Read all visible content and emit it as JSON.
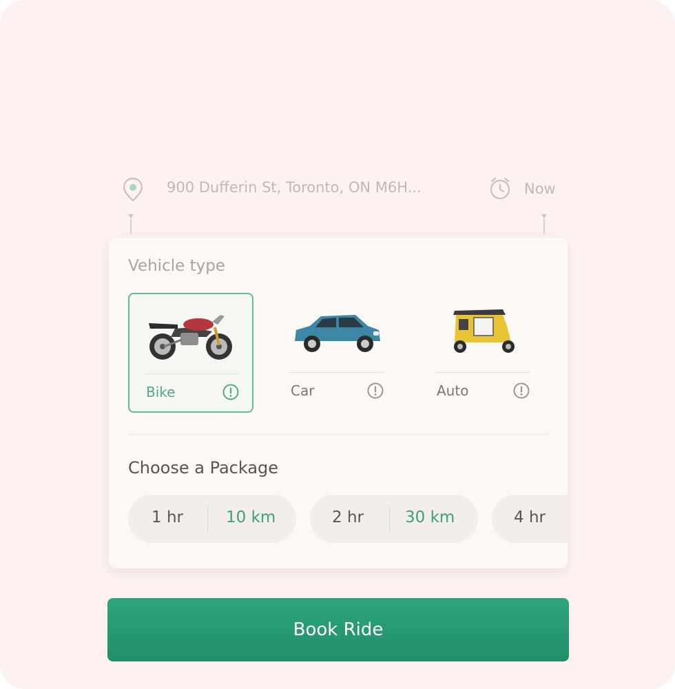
{
  "location": {
    "address": "900 Dufferin St, Toronto, ON M6H...",
    "time": "Now"
  },
  "vehicle_section": {
    "title": "Vehicle type",
    "options": [
      {
        "label": "Bike",
        "selected": true,
        "icon": "motorcycle-image"
      },
      {
        "label": "Car",
        "selected": false,
        "icon": "car-image"
      },
      {
        "label": "Auto",
        "selected": false,
        "icon": "auto-rickshaw-image"
      }
    ]
  },
  "package_section": {
    "title": "Choose a Package",
    "packages": [
      {
        "hours": "1 hr",
        "km": "10 km"
      },
      {
        "hours": "2 hr",
        "km": "30 km"
      },
      {
        "hours": "4 hr",
        "km": ""
      }
    ]
  },
  "book_button": {
    "label": "Book Ride"
  },
  "colors": {
    "accent": "#2ea57d",
    "selected_border": "#61bb94",
    "background": "#fdf2ef"
  }
}
